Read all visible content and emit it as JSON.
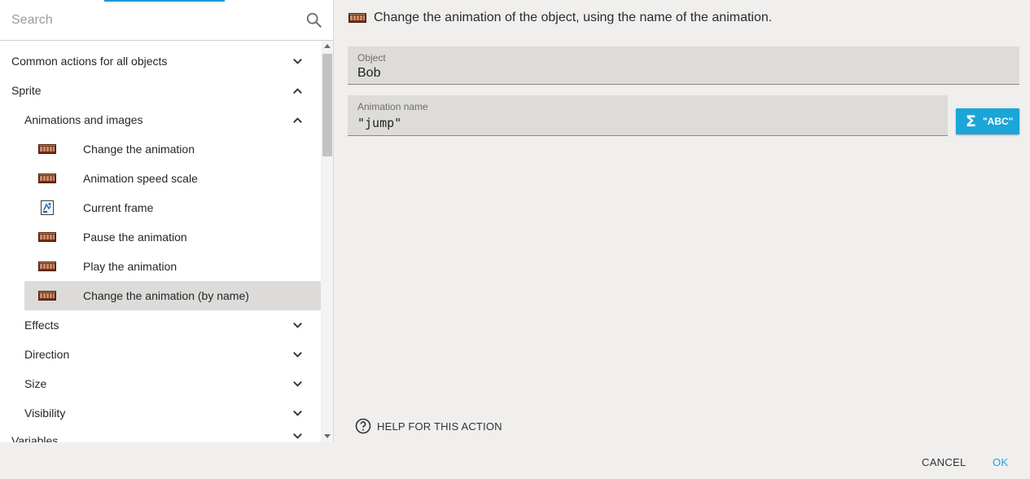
{
  "search": {
    "placeholder": "Search"
  },
  "tree": [
    {
      "label": "Common actions for all objects",
      "level": 0,
      "state": "collapsed"
    },
    {
      "label": "Sprite",
      "level": 0,
      "state": "expanded"
    },
    {
      "label": "Animations and images",
      "level": 1,
      "state": "expanded"
    },
    {
      "label": "Change the animation",
      "level": 2,
      "icon": "filmstrip-icon"
    },
    {
      "label": "Animation speed scale",
      "level": 2,
      "icon": "filmstrip-icon"
    },
    {
      "label": "Current frame",
      "level": 2,
      "icon": "current-frame-icon"
    },
    {
      "label": "Pause the animation",
      "level": 2,
      "icon": "filmstrip-icon"
    },
    {
      "label": "Play the animation",
      "level": 2,
      "icon": "filmstrip-icon"
    },
    {
      "label": "Change the animation (by name)",
      "level": 2,
      "icon": "filmstrip-icon",
      "selected": true
    },
    {
      "label": "Effects",
      "level": 1,
      "state": "collapsed"
    },
    {
      "label": "Direction",
      "level": 1,
      "state": "collapsed"
    },
    {
      "label": "Size",
      "level": 1,
      "state": "collapsed"
    },
    {
      "label": "Visibility",
      "level": 1,
      "state": "collapsed"
    },
    {
      "label": "Variables",
      "level": 0,
      "state": "collapsed"
    }
  ],
  "action": {
    "description": "Change the animation of the object, using the name of the animation.",
    "object_label": "Object",
    "object_value": "Bob",
    "animation_label": "Animation name",
    "animation_value": "\"jump\"",
    "expr_button_label": "\"ABC\"",
    "help_label": "HELP FOR THIS ACTION"
  },
  "footer": {
    "cancel": "CANCEL",
    "ok": "OK"
  },
  "colors": {
    "accent": "#1aa6d8",
    "selected_row": "#dcdbd9",
    "panel_bg": "#f0efee"
  }
}
